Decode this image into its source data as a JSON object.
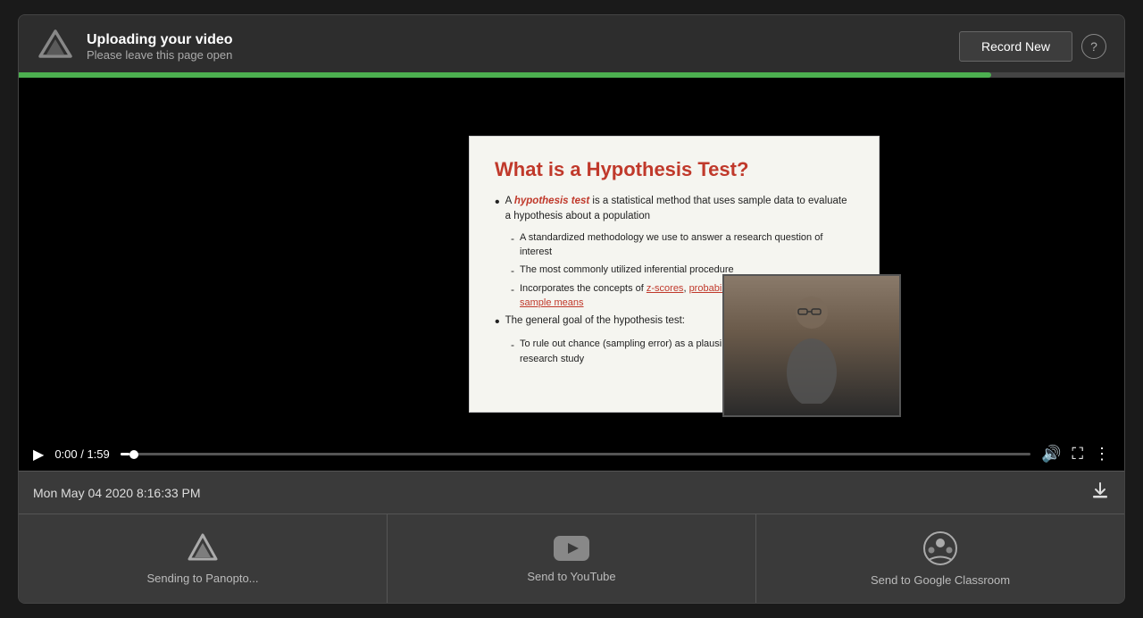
{
  "header": {
    "logo_alt": "Panopto logo",
    "title": "Uploading your video",
    "subtitle": "Please leave this page open",
    "progress_percent": 88,
    "record_new_label": "Record New",
    "help_icon": "?"
  },
  "video": {
    "slide": {
      "title": "What is a Hypothesis Test?",
      "bullet1_pre": "A ",
      "bullet1_italic": "hypothesis test",
      "bullet1_post": " is a statistical method that uses sample data to evaluate a hypothesis about a population",
      "sub1": "A standardized methodology we use to answer a research question of interest",
      "sub2": "The most commonly utilized inferential procedure",
      "sub3_pre": "Incorporates the concepts of ",
      "sub3_link1": "z-scores",
      "sub3_mid": ", ",
      "sub3_link2": "probability",
      "sub3_post": ", and the distribution of sample means",
      "bullet2": "The general goal of the hypothesis test:",
      "sub4_pre": "To rule out chance (sampling error) as a plausible the results from a research study"
    },
    "controls": {
      "current_time": "0:00",
      "total_time": "1:59",
      "time_display": "0:00 / 1:59"
    }
  },
  "info_bar": {
    "timestamp": "Mon May 04 2020 8:16:33 PM",
    "download_icon": "⬇"
  },
  "share_bar": {
    "items": [
      {
        "id": "panopto",
        "label": "Sending to Panopto...",
        "icon_type": "panopto"
      },
      {
        "id": "youtube",
        "label": "Send to YouTube",
        "icon_type": "youtube"
      },
      {
        "id": "google-classroom",
        "label": "Send to Google Classroom",
        "icon_type": "classroom"
      }
    ]
  }
}
